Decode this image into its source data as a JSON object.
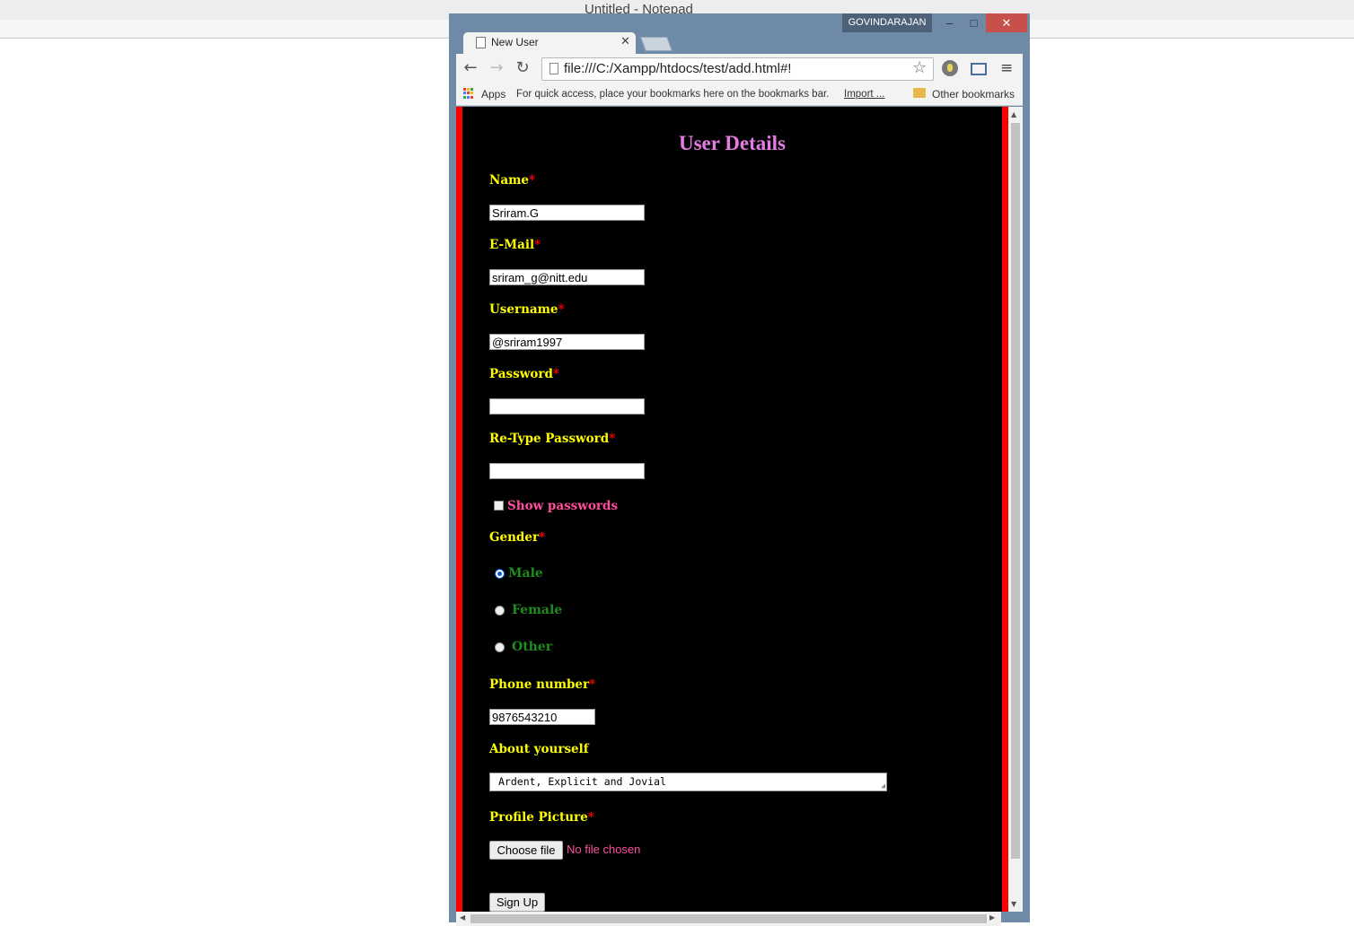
{
  "notepad": {
    "title": "Untitled - Notepad"
  },
  "window": {
    "user": "GOVINDARAJAN",
    "min": "–",
    "max": "□",
    "close": "✕"
  },
  "tab": {
    "title": "New User",
    "close": "✕"
  },
  "toolbar": {
    "back": "←",
    "forward": "→",
    "reload": "↻",
    "url": "file:///C:/Xampp/htdocs/test/add.html#!",
    "star": "☆",
    "menu": "≡"
  },
  "bookmarks": {
    "apps": "Apps",
    "hint": "For quick access, place your bookmarks here on the bookmarks bar.",
    "import": "Import ...",
    "other": "Other bookmarks",
    "apps_colors": [
      "#e94335",
      "#fbbc05",
      "#34a853",
      "#4285f4",
      "#e94335",
      "#fbbc05",
      "#34a853",
      "#4285f4",
      "#e94335"
    ]
  },
  "form": {
    "title": "User Details",
    "required_mark": "*",
    "name_label": "Name",
    "name_value": "Sriram.G",
    "email_label": "E-Mail",
    "email_value": "sriram_g@nitt.edu",
    "username_label": "Username",
    "username_value": "@sriram1997",
    "password_label": "Password",
    "password_value": "",
    "retype_label": "Re-Type Password",
    "retype_value": "",
    "show_passwords": "Show passwords",
    "gender_label": "Gender",
    "gender_options": [
      "Male",
      "Female",
      "Other"
    ],
    "gender_selected": "Male",
    "phone_label": "Phone number",
    "phone_value": "9876543210",
    "about_label": "About yourself",
    "about_value": "Ardent, Explicit and Jovial",
    "picture_label": "Profile Picture",
    "choose_file": "Choose file",
    "no_file": "No file chosen",
    "signup": "Sign Up"
  },
  "colors": {
    "page_bg": "#000000",
    "border": "#ff0000",
    "title": "#e47ce4",
    "label": "#ffff00",
    "required": "#ff0000",
    "radio_text": "#1f8c1f",
    "pink_text": "#ff4d9e"
  }
}
